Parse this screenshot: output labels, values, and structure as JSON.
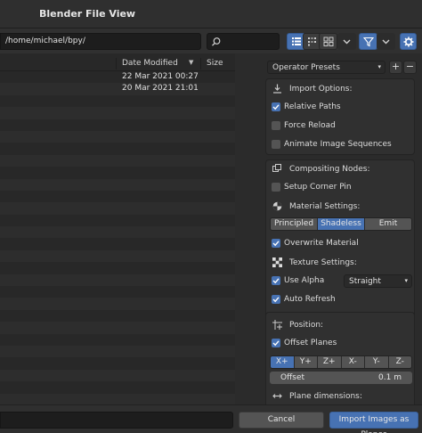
{
  "window": {
    "title": "Blender File View"
  },
  "toolbar": {
    "path": "/home/michael/bpy/",
    "search_placeholder": "",
    "icons": [
      "search-icon",
      "vertical-list-icon",
      "horizontal-list-icon",
      "thumbnails-icon",
      "chevron-down-icon",
      "filter-icon",
      "chevron-down-icon",
      "gear-icon"
    ]
  },
  "file_list": {
    "columns": {
      "date": "Date Modified",
      "size": "Size"
    },
    "sort_arrow": "▼",
    "rows": [
      {
        "date": "22 Mar 2021 00:27"
      },
      {
        "date": "20 Mar 2021 21:01"
      }
    ]
  },
  "operator": {
    "presets_label": "Operator Presets",
    "import_options": {
      "title": "Import Options:",
      "relative_paths": {
        "label": "Relative Paths",
        "checked": true
      },
      "force_reload": {
        "label": "Force Reload",
        "checked": false
      },
      "animate_sequences": {
        "label": "Animate Image Sequences",
        "checked": false
      }
    },
    "compositing": {
      "title": "Compositing Nodes:",
      "setup_corner_pin": {
        "label": "Setup Corner Pin",
        "checked": false
      }
    },
    "material": {
      "title": "Material Settings:",
      "shaders": [
        "Principled",
        "Shadeless",
        "Emit"
      ],
      "selected_shader": "Shadeless",
      "overwrite": {
        "label": "Overwrite Material",
        "checked": true
      }
    },
    "texture": {
      "title": "Texture Settings:",
      "use_alpha": {
        "label": "Use Alpha",
        "checked": true
      },
      "alpha_mode": "Straight",
      "auto_refresh": {
        "label": "Auto Refresh",
        "checked": true
      }
    },
    "position": {
      "title": "Position:",
      "offset_planes": {
        "label": "Offset Planes",
        "checked": true
      },
      "axes": [
        "X+",
        "Y+",
        "Z+",
        "X-",
        "Y-",
        "Z-"
      ],
      "selected_axis": "X+",
      "offset": {
        "label": "Offset",
        "value": "0.1 m"
      },
      "plane_dimensions_title": "Plane dimensions:"
    }
  },
  "bottom": {
    "filename": "",
    "cancel_label": "Cancel",
    "import_label": "Import Images as Planes"
  },
  "colors": {
    "accent": "#4772b3",
    "panel_bg": "#303030",
    "window_bg": "#2b2b2b"
  }
}
